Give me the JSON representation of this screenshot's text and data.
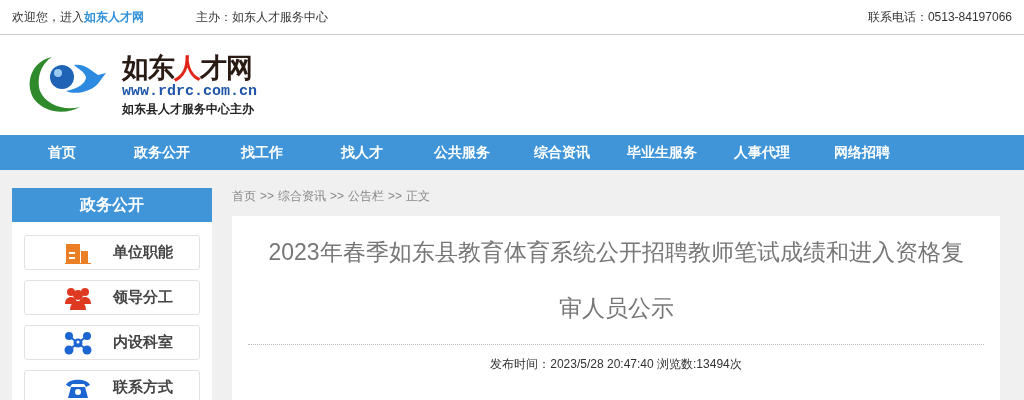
{
  "top_bar": {
    "welcome": "欢迎您，进入",
    "site_link": "如东人才网",
    "sponsor": "主办：如东人才服务中心",
    "phone": "联系电话：0513-84197066"
  },
  "logo": {
    "title": [
      {
        "text": "如东",
        "color": "#2a1a14"
      },
      {
        "text": "人",
        "color": "#e0261b"
      },
      {
        "text": "才网",
        "color": "#2a1a14"
      }
    ],
    "url": "www.rdrc.com.cn",
    "subtitle": "如东县人才服务中心主办"
  },
  "nav": [
    {
      "label": "首页"
    },
    {
      "label": "政务公开"
    },
    {
      "label": "找工作"
    },
    {
      "label": "找人才"
    },
    {
      "label": "公共服务"
    },
    {
      "label": "综合资讯"
    },
    {
      "label": "毕业生服务"
    },
    {
      "label": "人事代理"
    },
    {
      "label": "网络招聘"
    }
  ],
  "sidebar": {
    "title": "政务公开",
    "items": [
      {
        "label": "单位职能",
        "kind": "building"
      },
      {
        "label": "领导分工",
        "kind": "people"
      },
      {
        "label": "内设科室",
        "kind": "network"
      },
      {
        "label": "联系方式",
        "kind": "phone"
      }
    ]
  },
  "breadcrumb": [
    "首页",
    "综合资讯",
    "公告栏",
    "正文"
  ],
  "breadcrumb_separator": ">>",
  "article": {
    "title": "2023年春季如东县教育体育系统公开招聘教师笔试成绩和进入资格复审人员公示",
    "meta": "发布时间：2023/5/28 20:47:40 浏览数:13494次"
  }
}
